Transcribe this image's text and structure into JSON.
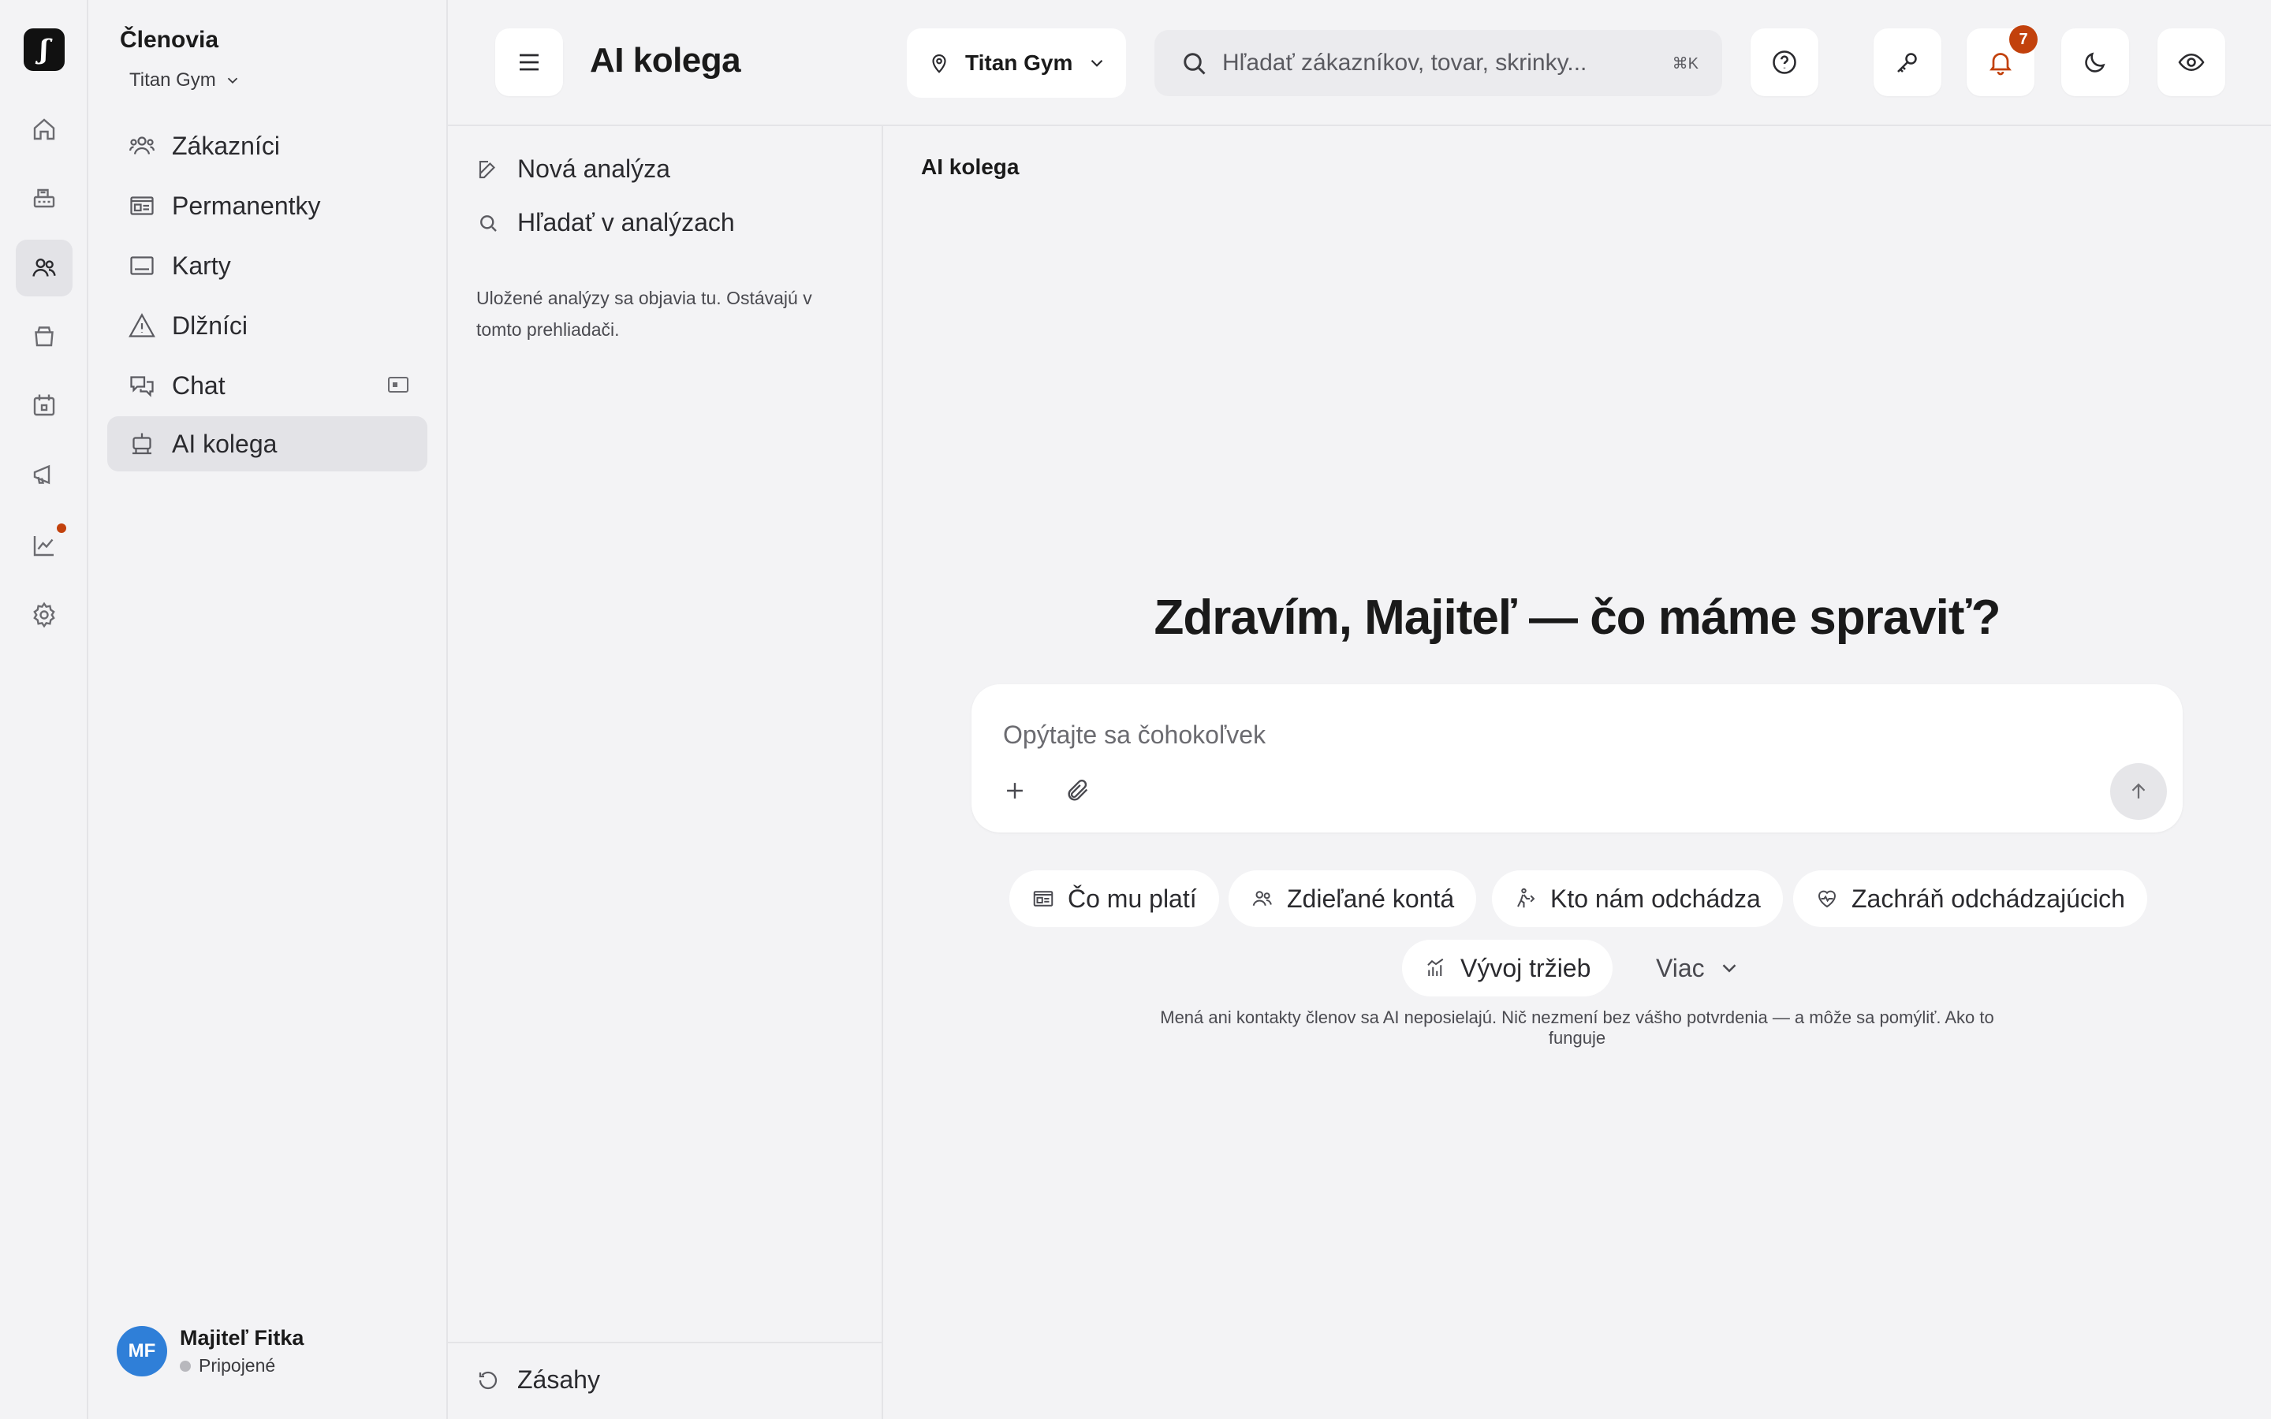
{
  "rail": {
    "logo_glyph": "ʃ",
    "items": [
      "home-icon",
      "register-icon",
      "members-icon",
      "store-icon",
      "calendar-icon",
      "megaphone-icon",
      "analytics-icon",
      "settings-icon"
    ]
  },
  "sidebar": {
    "title": "Členovia",
    "gym": "Titan Gym",
    "items": [
      {
        "label": "Zákazníci"
      },
      {
        "label": "Permanentky"
      },
      {
        "label": "Karty"
      },
      {
        "label": "Dlžníci"
      },
      {
        "label": "Chat"
      },
      {
        "label": "AI kolega"
      }
    ],
    "user": {
      "initials": "MF",
      "name": "Majiteľ Fitka",
      "status": "Pripojené"
    }
  },
  "header": {
    "title": "AI kolega",
    "gym_select": "Titan Gym",
    "search_placeholder": "Hľadať zákazníkov, tovar, skrinky...",
    "search_shortcut": "⌘K",
    "notifications_count": "7"
  },
  "panel": {
    "new_analysis": "Nová analýza",
    "search_analyses": "Hľadať v analýzach",
    "note": "Uložené analýzy sa objavia tu. Ostávajú v tomto prehliadači.",
    "footer": "Zásahy"
  },
  "main": {
    "crumb": "AI kolega",
    "greeting": "Zdravím, Majiteľ — čo máme spraviť?",
    "composer_placeholder": "Opýtajte sa čohokoľvek",
    "chips": [
      "Čo mu platí",
      "Zdieľané kontá",
      "Kto nám odchádza",
      "Zachráň odchádzajúcich",
      "Vývoj tržieb"
    ],
    "more": "Viac",
    "disclaimer": "Mená ani kontakty členov sa AI neposielajú. Nič nezmení bez vášho potvrdenia — a môže sa pomýliť.",
    "disclaimer_link": "Ako to funguje"
  },
  "colors": {
    "accent": "#c2410c",
    "avatar": "#2f7fd8",
    "background": "#f3f3f5"
  }
}
